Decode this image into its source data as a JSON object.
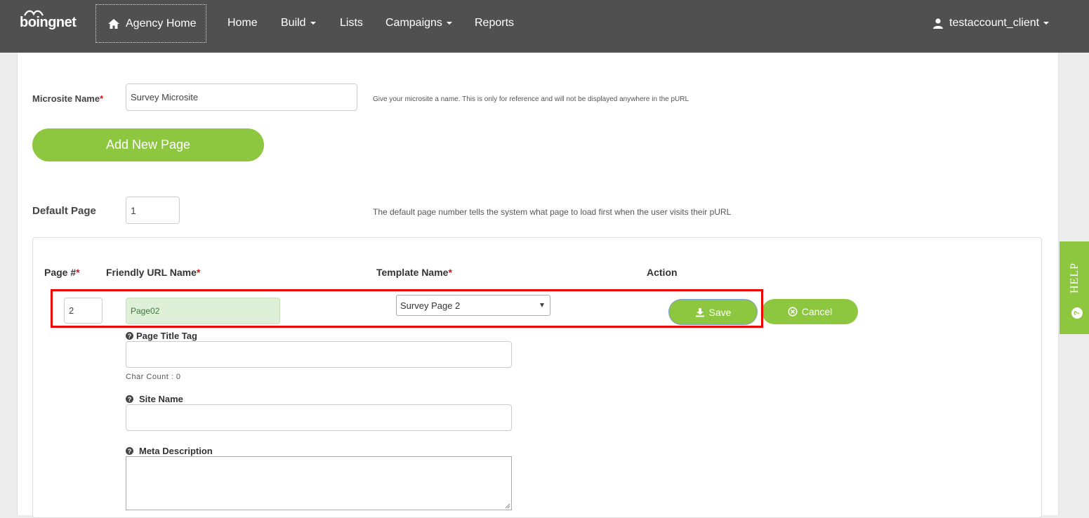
{
  "brand": {
    "logo_text": "boingnet"
  },
  "nav": {
    "agency_home": "Agency Home",
    "items": [
      {
        "label": "Home",
        "dropdown": false
      },
      {
        "label": "Build",
        "dropdown": true
      },
      {
        "label": "Lists",
        "dropdown": false
      },
      {
        "label": "Campaigns",
        "dropdown": true
      },
      {
        "label": "Reports",
        "dropdown": false
      }
    ],
    "user": "testaccount_client"
  },
  "form": {
    "microsite_name_label": "Microsite Name",
    "microsite_name_value": "Survey Microsite",
    "microsite_name_hint": "Give your microsite a name. This is only for reference and will not be displayed anywhere in the pURL",
    "add_page_button": "Add New Page",
    "default_page_label": "Default Page",
    "default_page_value": "1",
    "default_page_hint": "The default page number tells the system what page to load first when the user visits their pURL"
  },
  "table": {
    "headers": {
      "page_num": "Page #",
      "friendly_url": "Friendly URL Name",
      "template_name": "Template Name",
      "action": "Action"
    },
    "row": {
      "page_num": "2",
      "friendly_url": "Page02",
      "template": "Survey Page 2",
      "save": "Save",
      "cancel": "Cancel"
    },
    "page_title_tag_label": "Page Title Tag",
    "char_count": "Char Count : 0",
    "site_name_label": "Site Name",
    "meta_description_label": "Meta Description"
  },
  "help": {
    "label": "HELP"
  },
  "colors": {
    "accent": "#8dc63f",
    "nav_bg": "#505050",
    "highlight": "#e00000",
    "required": "#d9121f"
  }
}
